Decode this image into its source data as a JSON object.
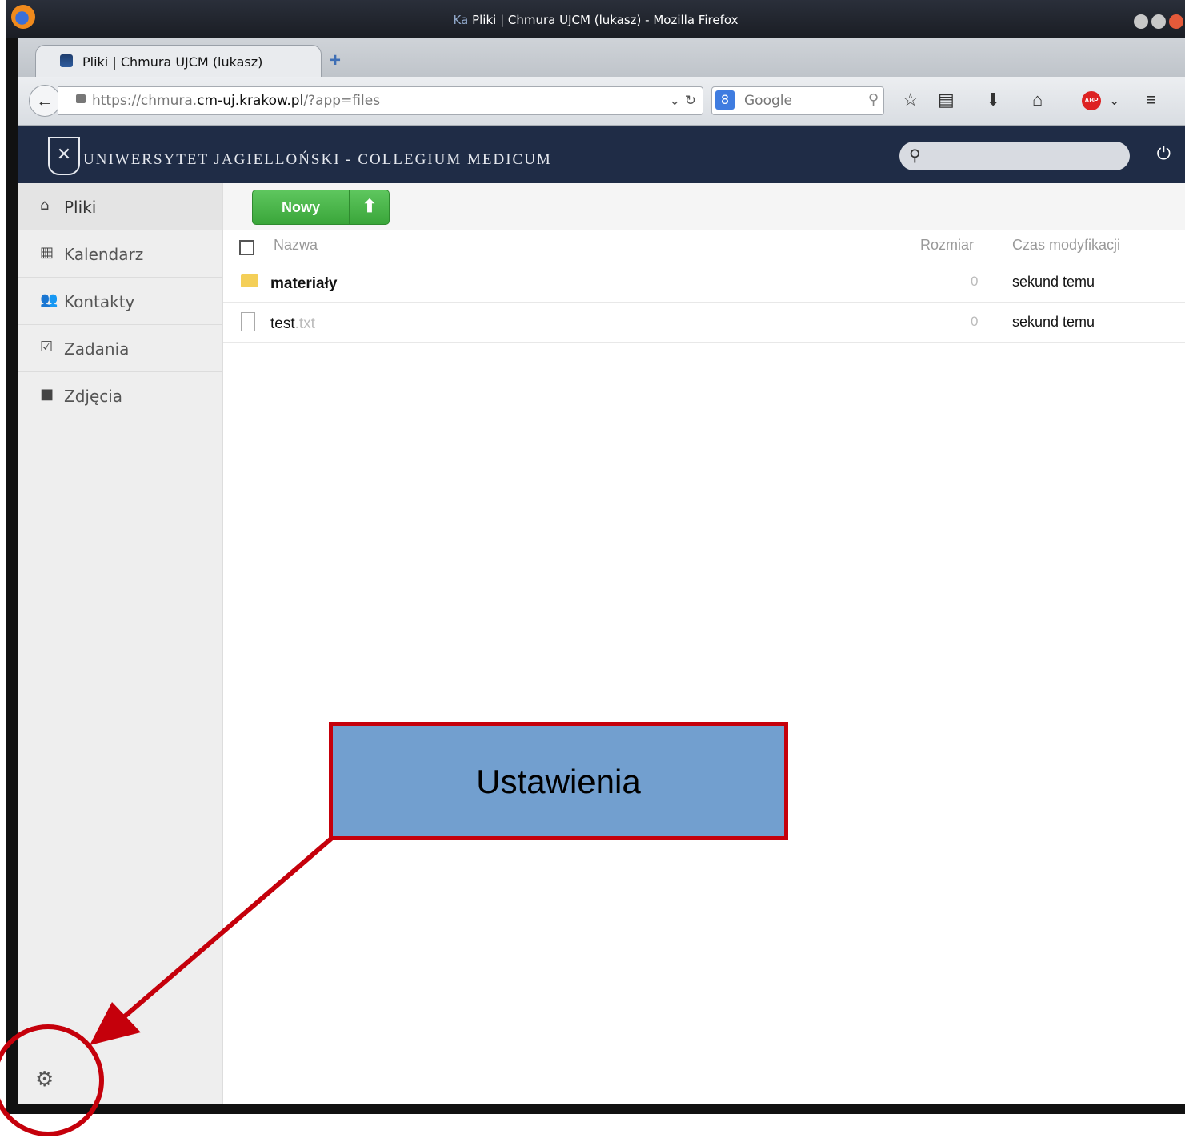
{
  "window": {
    "title_prefix": "Ka",
    "title": "Pliki | Chmura UJCM (lukasz) - Mozilla Firefox"
  },
  "tab": {
    "label": "Pliki | Chmura UJCM (lukasz)",
    "new_tab_symbol": "+"
  },
  "navbar": {
    "url_prefix": "https://chmura.",
    "url_domain": "cm-uj.krakow.pl",
    "url_suffix": "/?app=files",
    "search_placeholder": "Google"
  },
  "app": {
    "brand": "UNIWERSYTET JAGIELLOŃSKI - COLLEGIUM MEDICUM"
  },
  "sidebar": {
    "items": [
      {
        "label": "Pliki",
        "icon": "home-icon",
        "active": true
      },
      {
        "label": "Kalendarz",
        "icon": "calendar-icon"
      },
      {
        "label": "Kontakty",
        "icon": "contacts-icon"
      },
      {
        "label": "Zadania",
        "icon": "tasks-icon"
      },
      {
        "label": "Zdjęcia",
        "icon": "photos-icon"
      }
    ],
    "settings_icon": "gear-icon"
  },
  "controls": {
    "new_label": "Nowy",
    "upload_icon": "upload-arrow-icon"
  },
  "table": {
    "headers": {
      "name": "Nazwa",
      "size": "Rozmiar",
      "modified": "Czas modyfikacji"
    },
    "rows": [
      {
        "name": "materiały",
        "ext": "",
        "type": "folder",
        "size": "0",
        "modified": "sekund temu"
      },
      {
        "name": "test",
        "ext": ".txt",
        "type": "file",
        "size": "0",
        "modified": "sekund temu"
      }
    ]
  },
  "annotation": {
    "label": "Ustawienia",
    "color": "#c5000b",
    "fill": "#729fcf"
  }
}
